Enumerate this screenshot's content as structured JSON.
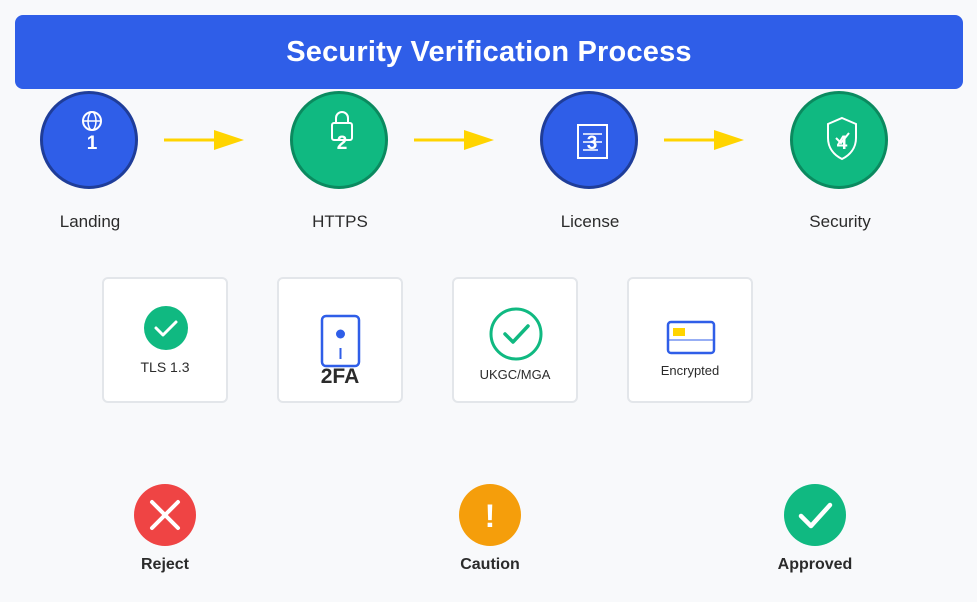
{
  "title": "Security Verification Process",
  "steps": [
    {
      "number": "1",
      "label": "Landing",
      "icon": "globe-icon",
      "color": "#2f5ee8"
    },
    {
      "number": "2",
      "label": "HTTPS",
      "icon": "lock-icon",
      "color": "#10b981"
    },
    {
      "number": "3",
      "label": "License",
      "icon": "document-icon",
      "color": "#2f5ee8"
    },
    {
      "number": "4",
      "label": "Security",
      "icon": "shield-icon",
      "color": "#10b981"
    }
  ],
  "arrow_color": "#ffd400",
  "cards": [
    {
      "label": "TLS 1.3",
      "icon": "check-circle-icon"
    },
    {
      "label": "2FA",
      "icon": "phone-icon"
    },
    {
      "label": "UKGC/MGA",
      "icon": "check-ring-icon"
    },
    {
      "label": "Encrypted",
      "icon": "credit-card-icon"
    }
  ],
  "decisions": [
    {
      "label": "Reject",
      "symbol": "!",
      "color": "#ef4444"
    },
    {
      "label": "Caution",
      "symbol": "!",
      "color": "#f59e0b"
    },
    {
      "label": "Approved",
      "color": "#10b981"
    }
  ]
}
